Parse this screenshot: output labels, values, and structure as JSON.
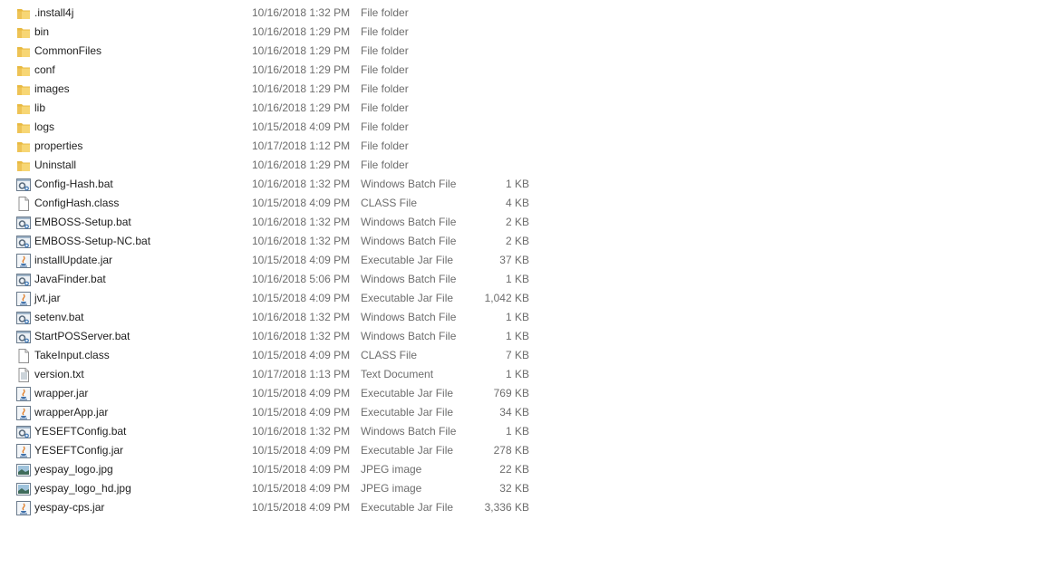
{
  "file_list": {
    "items": [
      {
        "name": ".install4j",
        "date": "10/16/2018 1:32 PM",
        "type": "File folder",
        "size": "",
        "icon": "folder-icon"
      },
      {
        "name": "bin",
        "date": "10/16/2018 1:29 PM",
        "type": "File folder",
        "size": "",
        "icon": "folder-icon"
      },
      {
        "name": "CommonFiles",
        "date": "10/16/2018 1:29 PM",
        "type": "File folder",
        "size": "",
        "icon": "folder-icon"
      },
      {
        "name": "conf",
        "date": "10/16/2018 1:29 PM",
        "type": "File folder",
        "size": "",
        "icon": "folder-icon"
      },
      {
        "name": "images",
        "date": "10/16/2018 1:29 PM",
        "type": "File folder",
        "size": "",
        "icon": "folder-icon"
      },
      {
        "name": "lib",
        "date": "10/16/2018 1:29 PM",
        "type": "File folder",
        "size": "",
        "icon": "folder-icon"
      },
      {
        "name": "logs",
        "date": "10/15/2018 4:09 PM",
        "type": "File folder",
        "size": "",
        "icon": "folder-icon"
      },
      {
        "name": "properties",
        "date": "10/17/2018 1:12 PM",
        "type": "File folder",
        "size": "",
        "icon": "folder-icon"
      },
      {
        "name": "Uninstall",
        "date": "10/16/2018 1:29 PM",
        "type": "File folder",
        "size": "",
        "icon": "folder-icon"
      },
      {
        "name": "Config-Hash.bat",
        "date": "10/16/2018 1:32 PM",
        "type": "Windows Batch File",
        "size": "1 KB",
        "icon": "batch-file-icon"
      },
      {
        "name": "ConfigHash.class",
        "date": "10/15/2018 4:09 PM",
        "type": "CLASS File",
        "size": "4 KB",
        "icon": "blank-file-icon"
      },
      {
        "name": "EMBOSS-Setup.bat",
        "date": "10/16/2018 1:32 PM",
        "type": "Windows Batch File",
        "size": "2 KB",
        "icon": "batch-file-icon"
      },
      {
        "name": "EMBOSS-Setup-NC.bat",
        "date": "10/16/2018 1:32 PM",
        "type": "Windows Batch File",
        "size": "2 KB",
        "icon": "batch-file-icon"
      },
      {
        "name": "installUpdate.jar",
        "date": "10/15/2018 4:09 PM",
        "type": "Executable Jar File",
        "size": "37 KB",
        "icon": "java-jar-icon"
      },
      {
        "name": "JavaFinder.bat",
        "date": "10/16/2018 5:06 PM",
        "type": "Windows Batch File",
        "size": "1 KB",
        "icon": "batch-file-icon"
      },
      {
        "name": "jvt.jar",
        "date": "10/15/2018 4:09 PM",
        "type": "Executable Jar File",
        "size": "1,042 KB",
        "icon": "java-jar-icon"
      },
      {
        "name": "setenv.bat",
        "date": "10/16/2018 1:32 PM",
        "type": "Windows Batch File",
        "size": "1 KB",
        "icon": "batch-file-icon"
      },
      {
        "name": "StartPOSServer.bat",
        "date": "10/16/2018 1:32 PM",
        "type": "Windows Batch File",
        "size": "1 KB",
        "icon": "batch-file-icon"
      },
      {
        "name": "TakeInput.class",
        "date": "10/15/2018 4:09 PM",
        "type": "CLASS File",
        "size": "7 KB",
        "icon": "blank-file-icon"
      },
      {
        "name": "version.txt",
        "date": "10/17/2018 1:13 PM",
        "type": "Text Document",
        "size": "1 KB",
        "icon": "text-file-icon"
      },
      {
        "name": "wrapper.jar",
        "date": "10/15/2018 4:09 PM",
        "type": "Executable Jar File",
        "size": "769 KB",
        "icon": "java-jar-icon"
      },
      {
        "name": "wrapperApp.jar",
        "date": "10/15/2018 4:09 PM",
        "type": "Executable Jar File",
        "size": "34 KB",
        "icon": "java-jar-icon"
      },
      {
        "name": "YESEFTConfig.bat",
        "date": "10/16/2018 1:32 PM",
        "type": "Windows Batch File",
        "size": "1 KB",
        "icon": "batch-file-icon"
      },
      {
        "name": "YESEFTConfig.jar",
        "date": "10/15/2018 4:09 PM",
        "type": "Executable Jar File",
        "size": "278 KB",
        "icon": "java-jar-icon"
      },
      {
        "name": "yespay_logo.jpg",
        "date": "10/15/2018 4:09 PM",
        "type": "JPEG image",
        "size": "22 KB",
        "icon": "image-file-icon"
      },
      {
        "name": "yespay_logo_hd.jpg",
        "date": "10/15/2018 4:09 PM",
        "type": "JPEG image",
        "size": "32 KB",
        "icon": "image-file-icon"
      },
      {
        "name": "yespay-cps.jar",
        "date": "10/15/2018 4:09 PM",
        "type": "Executable Jar File",
        "size": "3,336 KB",
        "icon": "java-jar-icon"
      }
    ]
  }
}
